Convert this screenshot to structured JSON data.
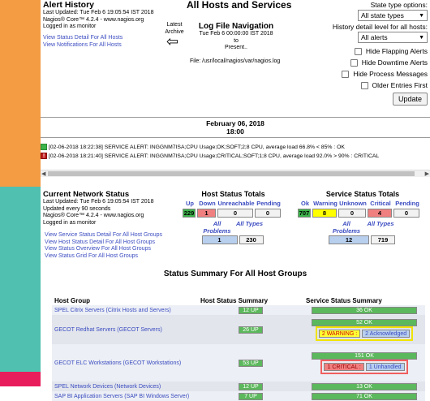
{
  "alert_history": {
    "title": "Alert History",
    "last_updated": "Last Updated: Tue Feb 6 19:05:54 IST 2018",
    "version": "Nagios® Core™ 4.2.4 - www.nagios.org",
    "logged_in": "Logged in as monitor",
    "links": [
      "View Status Detail For All Hosts",
      "View Notifications For All Hosts"
    ]
  },
  "center": {
    "title": "All Hosts and Services",
    "latest_archive": "Latest Archive",
    "arrow": "⇦",
    "nav_title": "Log File Navigation",
    "nav_range": [
      "Tue Feb 6 00:00:00 IST 2018",
      "to",
      "Present.."
    ],
    "file_path": "File: /usr/local/nagios/var/nagios.log"
  },
  "options": {
    "state_type_label": "State type options:",
    "state_type_value": "All state types",
    "detail_label": "History detail level for all hosts:",
    "detail_value": "All alerts",
    "checkboxes": [
      "Hide Flapping Alerts",
      "Hide Downtime Alerts",
      "Hide Process Messages",
      "Older Entries First"
    ],
    "update_button": "Update"
  },
  "log": {
    "date": "February 06, 2018",
    "time": "18:00",
    "entries": [
      {
        "status": "ok",
        "text": "[02-06-2018 18:22:38] SERVICE ALERT: INGGNM7ISA;CPU Usage;OK;SOFT;2;8 CPU, average load 66.8% < 85% : OK"
      },
      {
        "status": "critical",
        "text": "[02-06-2018 18:21:40] SERVICE ALERT: INGGNM7ISA;CPU Usage;CRITICAL;SOFT;1;8 CPU, average load 92.0% > 90% : CRITICAL"
      }
    ]
  },
  "network_status": {
    "title": "Current Network Status",
    "last_updated": "Last Updated: Tue Feb 6 19:05:54 IST 2018",
    "refresh": "Updated every 90 seconds",
    "version": "Nagios® Core™ 4.2.4 - www.nagios.org",
    "logged_in": "Logged in as monitor",
    "links": [
      "View Service Status Detail For All Host Groups",
      "View Host Status Detail For All Host Groups",
      "View Status Overview For All Host Groups",
      "View Status Grid For All Host Groups"
    ]
  },
  "host_totals": {
    "title": "Host Status Totals",
    "labels": [
      "Up",
      "Down",
      "Unreachable",
      "Pending"
    ],
    "values": [
      "229",
      "1",
      "0",
      "0"
    ],
    "problem_labels": [
      "All Problems",
      "All Types"
    ],
    "problem_values": [
      "1",
      "230"
    ]
  },
  "service_totals": {
    "title": "Service Status Totals",
    "labels": [
      "Ok",
      "Warning",
      "Unknown",
      "Critical",
      "Pending"
    ],
    "values": [
      "707",
      "8",
      "0",
      "4",
      "0"
    ],
    "problem_labels": [
      "All Problems",
      "All Types"
    ],
    "problem_values": [
      "12",
      "719"
    ]
  },
  "summary": {
    "title": "Status Summary For All Host Groups",
    "headers": [
      "Host Group",
      "Host Status Summary",
      "Service Status Summary"
    ],
    "rows": [
      {
        "name": "SPEL Citrix Servers (Citrix Hosts and Servers)",
        "host": "12 UP",
        "service_ok": "36 OK"
      },
      {
        "name": "GECOT Redhat Servers (GECOT Servers)",
        "host": "26 UP",
        "service_ok": "52 OK",
        "warning": "2 WARNING :",
        "ack": "2 Acknowledged"
      },
      {
        "name": "GECOT ELC Workstations (GECOT Workstations)",
        "host": "53 UP",
        "service_ok": "151 OK",
        "critical": "1 CRITICAL :",
        "unhandled": "1 Unhandled"
      },
      {
        "name": "SPEL Network Devices (Network Devices)",
        "host": "12 UP",
        "service_ok": "13 OK"
      },
      {
        "name": "SAP BI Application Servers (SAP BI Windows Server)",
        "host": "7 UP",
        "service_ok": "71 OK"
      }
    ]
  }
}
